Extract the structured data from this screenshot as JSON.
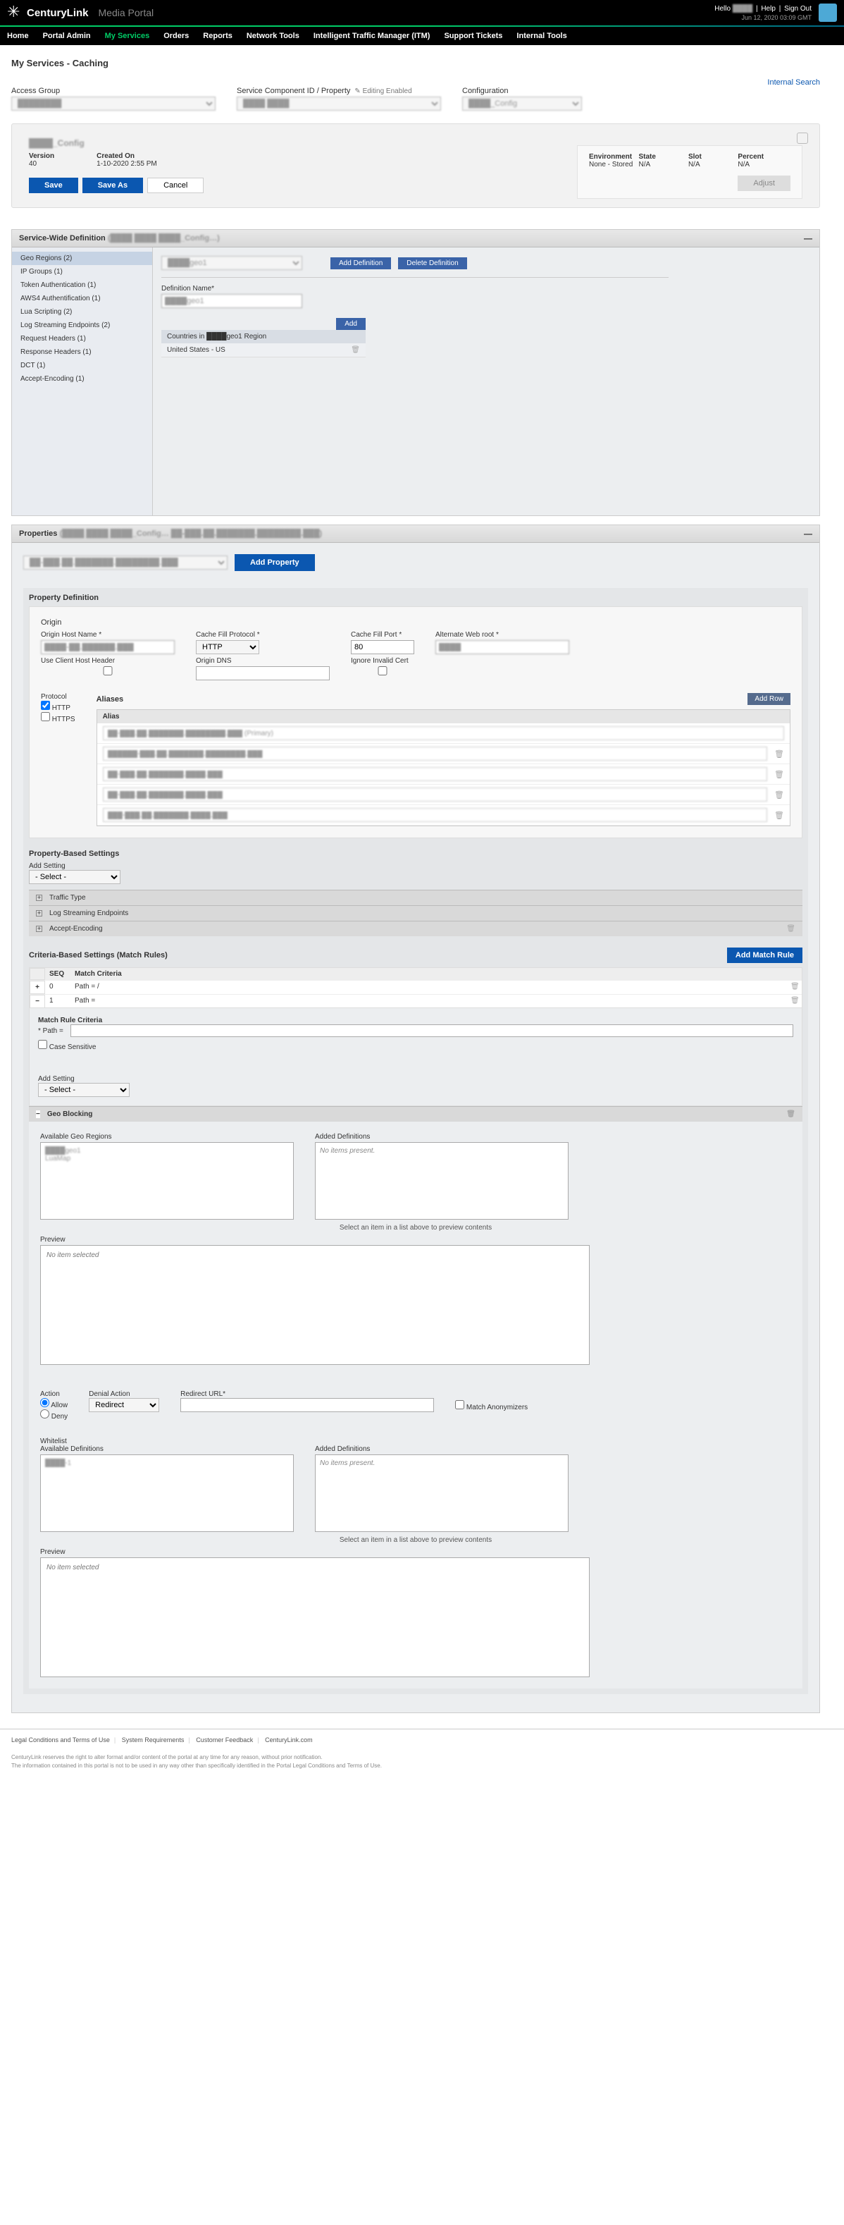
{
  "header": {
    "brand": "CenturyLink",
    "portal": "Media Portal",
    "hello": "Hello",
    "user": "████",
    "help": "Help",
    "signout": "Sign Out",
    "timestamp": "Jun 12, 2020 03:09 GMT"
  },
  "nav": {
    "home": "Home",
    "portal_admin": "Portal Admin",
    "my_services": "My Services",
    "orders": "Orders",
    "reports": "Reports",
    "network_tools": "Network Tools",
    "itm": "Intelligent Traffic Manager (ITM)",
    "support": "Support Tickets",
    "internal": "Internal Tools"
  },
  "page": {
    "title": "My Services - Caching",
    "internal_search": "Internal Search",
    "access_group_label": "Access Group",
    "scid_label": "Service Component ID / Property",
    "editing_enabled": "Editing Enabled",
    "configuration_label": "Configuration",
    "access_group_value": "████████",
    "scid_value": "████ ████",
    "config_value": "████_Config"
  },
  "card": {
    "name": "████_Config",
    "version_label": "Version",
    "version": "40",
    "created_label": "Created On",
    "created": "1-10-2020 2:55 PM",
    "save": "Save",
    "save_as": "Save As",
    "cancel": "Cancel",
    "env_label": "Environment",
    "env": "None - Stored",
    "state_label": "State",
    "state": "N/A",
    "slot_label": "Slot",
    "slot": "N/A",
    "percent_label": "Percent",
    "percent": "N/A",
    "adjust": "Adjust"
  },
  "swd": {
    "title": "Service-Wide Definition",
    "title_suffix": "(████ ████   ████_Config…)",
    "nav": [
      "Geo Regions (2)",
      "IP Groups (1)",
      "Token Authentication (1)",
      "AWS4 Authentification (1)",
      "Lua Scripting (2)",
      "Log Streaming Endpoints (2)",
      "Request Headers (1)",
      "Response Headers (1)",
      "DCT (1)",
      "Accept-Encoding (1)"
    ],
    "definition_value": "████geo1",
    "add_def": "Add Definition",
    "del_def": "Delete Definition",
    "def_name_label": "Definition Name*",
    "def_name_value": "████geo1",
    "add": "Add",
    "countries_head": "Countries in ████geo1 Region",
    "row1": "United States - US"
  },
  "props": {
    "title": "Properties",
    "title_suffix": "(████ ████   ████_Config…  ██-███.██.███████.████████.███)",
    "select_value": "██-███.██.███████.████████.███",
    "add_property": "Add Property",
    "pd_title": "Property Definition",
    "origin_title": "Origin",
    "ohn_label": "Origin Host Name *",
    "ohn_value": "████-██.██████.███",
    "uchh_label": "Use Client Host Header",
    "cfp_label": "Cache Fill Protocol *",
    "cfp_value": "HTTP",
    "odns_label": "Origin DNS",
    "cfport_label": "Cache Fill Port *",
    "cfport_value": "80",
    "iic_label": "Ignore Invalid Cert",
    "awr_label": "Alternate Web root *",
    "awr_value": "████",
    "protocol_label": "Protocol",
    "http": "HTTP",
    "https": "HTTPS",
    "aliases_label": "Aliases",
    "add_row": "Add Row",
    "alias_head": "Alias",
    "aliases": [
      "██-███.██.███████.████████.███ (Primary)",
      "██████-███.██.███████.████████.███",
      "██-███.██.███████.████.███",
      "██-███.██.███████.████.███",
      "███-███.██.███████.████.███"
    ],
    "pbs_title": "Property-Based Settings",
    "add_setting_label": "Add Setting",
    "select_placeholder": "- Select -",
    "settings": [
      "Traffic Type",
      "Log Streaming Endpoints",
      "Accept-Encoding"
    ],
    "cbs_title": "Criteria-Based Settings (Match Rules)",
    "add_match_rule": "Add Match Rule",
    "seq": "SEQ",
    "match_criteria": "Match Criteria",
    "rules": [
      {
        "seq": "0",
        "crit": "Path = /"
      },
      {
        "seq": "1",
        "crit": "Path ="
      }
    ],
    "mrc_label": "Match Rule Criteria",
    "path_label": "* Path =",
    "case_sensitive": "Case Sensitive",
    "geo_blocking": "Geo Blocking",
    "avail_geo": "Available Geo Regions",
    "added_def": "Added Definitions",
    "no_items": "No items present.",
    "geo_item1": "████geo1",
    "geo_item2": "LuaMap",
    "preview_hint": "Select an item in a list above to preview contents",
    "preview": "Preview",
    "no_item_sel": "No item selected",
    "action": "Action",
    "allow": "Allow",
    "deny": "Deny",
    "denial_action": "Denial Action",
    "redirect": "Redirect",
    "redirect_url": "Redirect URL*",
    "match_anon": "Match Anonymizers",
    "whitelist": "Whitelist",
    "avail_defs": "Available Definitions",
    "wl_item1": "████-1"
  },
  "footer": {
    "legal": "Legal Conditions and Terms of Use",
    "sysreq": "System Requirements",
    "feedback": "Customer Feedback",
    "ctl": "CenturyLink.com",
    "d1": "CenturyLink reserves the right to alter format and/or content of the portal at any time for any reason, without prior notification.",
    "d2": "The information contained in this portal is not to be used in any way other than specifically identified in the Portal Legal Conditions and Terms of Use."
  }
}
